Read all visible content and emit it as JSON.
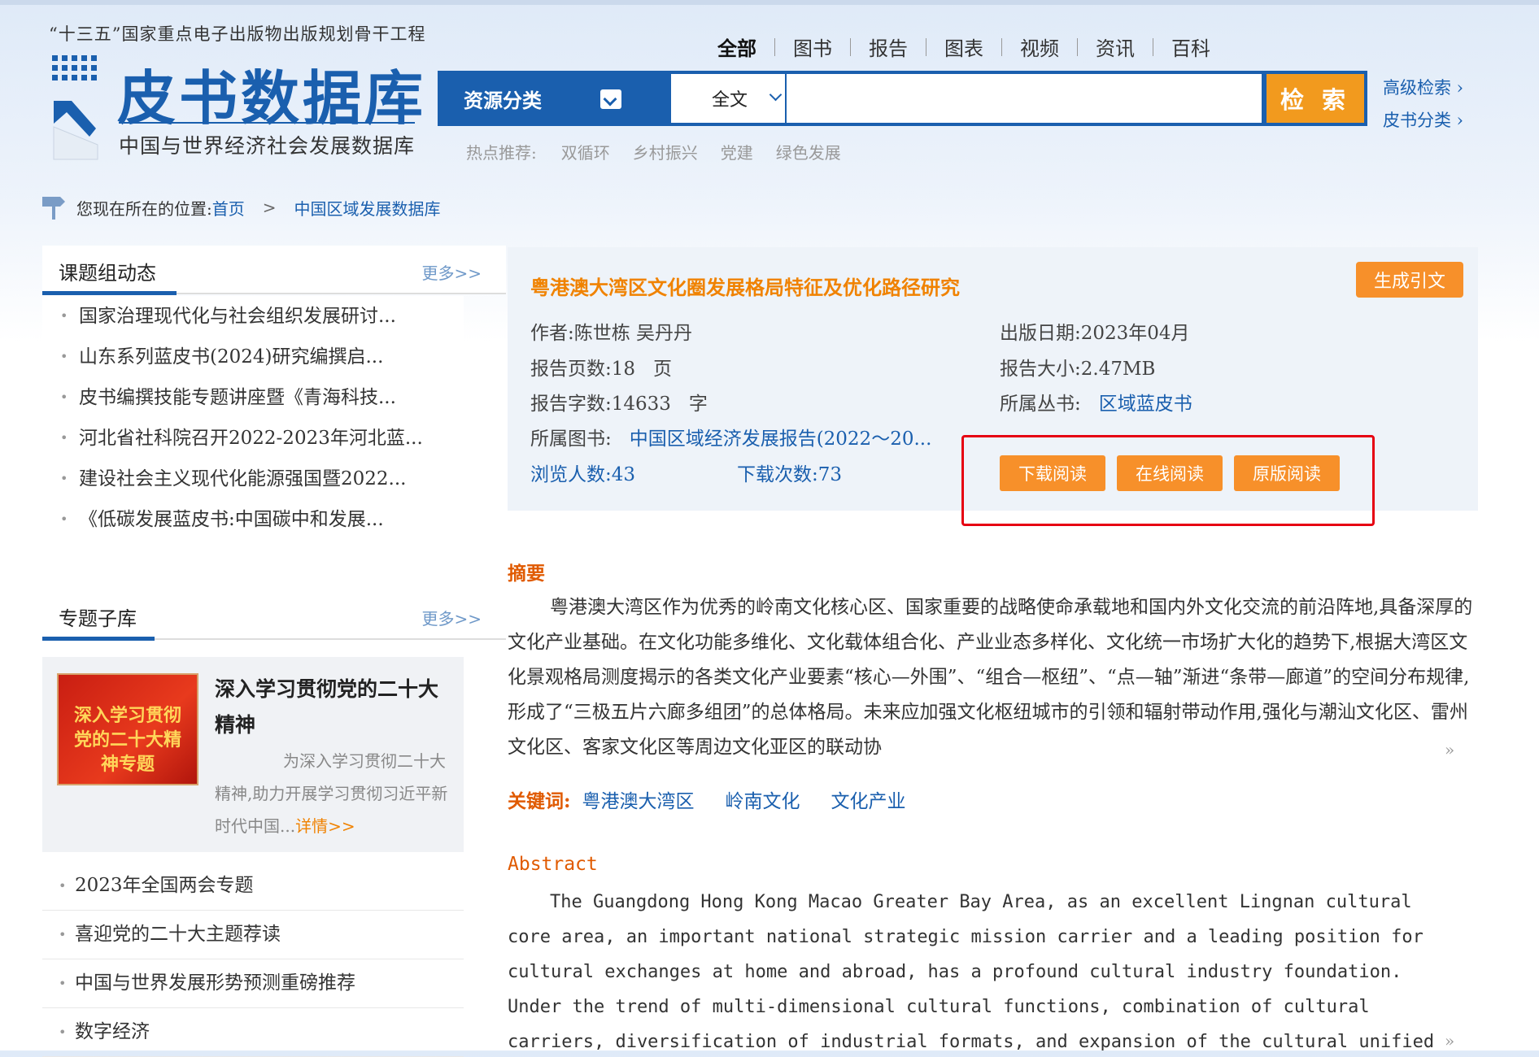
{
  "header": {
    "slogan": "“十三五”国家重点电子出版物出版规划骨干工程",
    "logo_title": "皮书数据库",
    "logo_subtitle": "中国与世界经济社会发展数据库",
    "tabs": [
      "全部",
      "图书",
      "报告",
      "图表",
      "视频",
      "资讯",
      "百科"
    ],
    "active_tab": "全部",
    "search": {
      "category_label": "资源分类",
      "field_value": "全文",
      "query_value": "",
      "button_label": "检 索"
    },
    "advanced_search": "高级检索 ›",
    "category_browse": "皮书分类 ›",
    "hot_label": "热点推荐:",
    "hot_keywords": [
      "双循环",
      "乡村振兴",
      "党建",
      "绿色发展"
    ]
  },
  "breadcrumb": {
    "prefix": "您现在所在的位置:",
    "home": "首页",
    "separator": ">",
    "current": "中国区域发展数据库"
  },
  "sidebar": {
    "group_news": {
      "title": "课题组动态",
      "more": "更多>>",
      "items": [
        "国家治理现代化与社会组织发展研讨...",
        "山东系列蓝皮书(2024)研究编撰启...",
        "皮书编撰技能专题讲座暨《青海科技...",
        "河北省社科院召开2022-2023年河北蓝...",
        "建设社会主义现代化能源强国暨2022...",
        "《低碳发展蓝皮书:中国碳中和发展..."
      ]
    },
    "topic_db": {
      "title": "专题子库",
      "more": "更多>>",
      "feature": {
        "image_text": "深入学习贯彻党的二十大精神专题",
        "title": "深入学习贯彻党的二十大精神",
        "desc": "为深入学习贯彻二十大精神,助力开展学习贯彻习近平新时代中国...",
        "detail": "详情>>"
      },
      "items": [
        "2023年全国两会专题",
        "喜迎党的二十大主题荐读",
        "中国与世界发展形势预测重磅推荐",
        "数字经济"
      ]
    }
  },
  "report": {
    "title": "粤港澳大湾区文化圈发展格局特征及优化路径研究",
    "cite_button": "生成引文",
    "author_label": "作者:",
    "authors": "陈世栋 吴丹丹",
    "pub_date_label": "出版日期:",
    "pub_date": "2023年04月",
    "pages_label": "报告页数:",
    "pages": "18",
    "pages_unit": "页",
    "size_label": "报告大小:",
    "size": "2.47MB",
    "words_label": "报告字数:",
    "words": "14633",
    "words_unit": "字",
    "series_label": "所属丛书:",
    "series": "区域蓝皮书",
    "book_label": "所属图书:",
    "book": "中国区域经济发展报告(2022～20...",
    "views_label": "浏览人数:",
    "views": "43",
    "downloads_label": "下载次数:",
    "downloads": "73",
    "actions": [
      "下载阅读",
      "在线阅读",
      "原版阅读"
    ]
  },
  "abstract": {
    "title": "摘要",
    "text": "粤港澳大湾区作为优秀的岭南文化核心区、国家重要的战略使命承载地和国内外文化交流的前沿阵地,具备深厚的文化产业基础。在文化功能多维化、文化载体组合化、产业业态多样化、文化统一市场扩大化的趋势下,根据大湾区文化景观格局测度揭示的各类文化产业要素“核心—外围”、“组合—枢纽”、“点—轴”渐进“条带—廊道”的空间分布规律,形成了“三极五片六廊多组团”的总体格局。未来应加强文化枢纽城市的引领和辐射带动作用,强化与潮汕文化区、雷州文化区、客家文化区等周边文化亚区的联动协",
    "expand": "»",
    "keywords_label": "关键词:",
    "keywords": [
      "粤港澳大湾区",
      "岭南文化",
      "文化产业"
    ]
  },
  "abstract_en": {
    "title": "Abstract",
    "text": "The Guangdong Hong Kong Macao Greater Bay Area, as an excellent Lingnan cultural core area, an important national strategic mission carrier and a leading position for cultural exchanges at home and abroad, has a profound cultural industry foundation. Under the trend of multi-dimensional cultural functions, combination of cultural carriers, diversification of industrial formats, and expansion of the cultural unified market, the overall pattern of",
    "expand": "»"
  },
  "colors": {
    "brand_blue": "#1a5fae",
    "accent_orange": "#f7902a",
    "highlight_red": "#e60012"
  }
}
